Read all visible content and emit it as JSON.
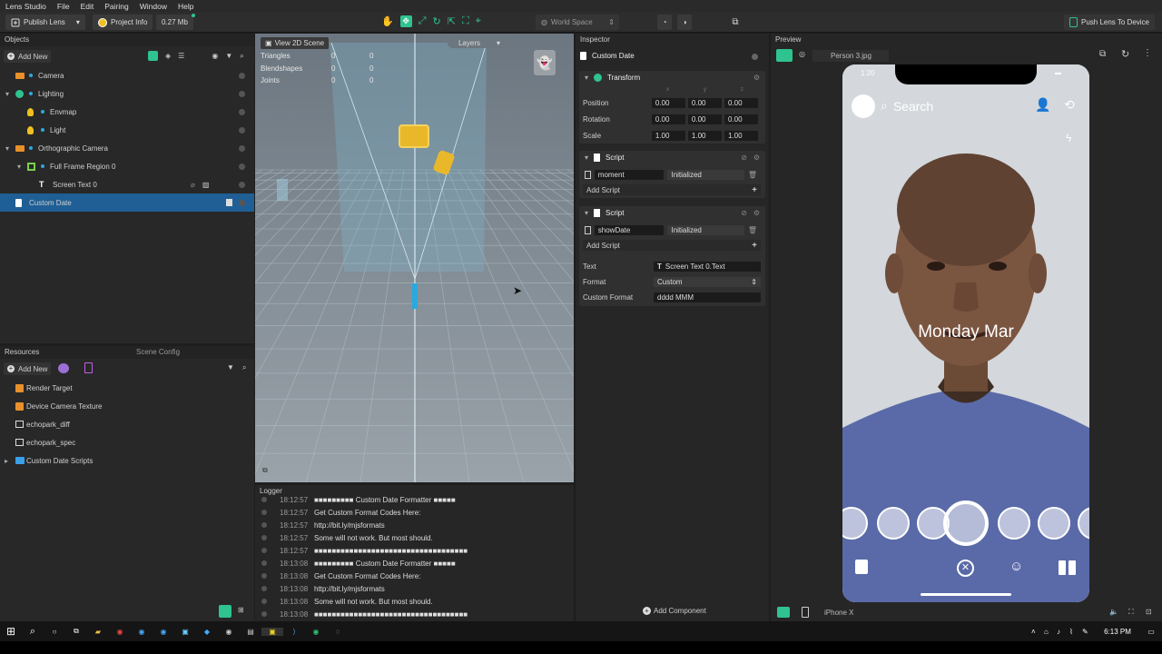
{
  "menu": [
    "Lens Studio",
    "File",
    "Edit",
    "Pairing",
    "Window",
    "Help"
  ],
  "toolbar": {
    "publish": "Publish Lens",
    "project_info": "Project Info",
    "size": "0.27 Mb",
    "space": "World Space",
    "push": "Push Lens To Device"
  },
  "objects": {
    "title": "Objects",
    "add_new": "Add New",
    "items": [
      {
        "label": "Camera",
        "indent": 0,
        "arrow": "",
        "icon": "camera",
        "color": "#e8902b"
      },
      {
        "label": "Lighting",
        "indent": 0,
        "arrow": "▾",
        "icon": "light-group",
        "color": "#2fc38f"
      },
      {
        "label": "Envmap",
        "indent": 1,
        "arrow": "",
        "icon": "bulb",
        "color": "#f0c020"
      },
      {
        "label": "Light",
        "indent": 1,
        "arrow": "",
        "icon": "bulb",
        "color": "#f0c020"
      },
      {
        "label": "Orthographic Camera",
        "indent": 0,
        "arrow": "▾",
        "icon": "camera",
        "color": "#e8902b"
      },
      {
        "label": "Full Frame Region 0",
        "indent": 1,
        "arrow": "▾",
        "icon": "frame",
        "color": "#7ad04a"
      },
      {
        "label": "Screen Text 0",
        "indent": 2,
        "arrow": "",
        "icon": "text",
        "color": "#ffffff"
      },
      {
        "label": "Custom Date",
        "indent": 0,
        "arrow": "",
        "icon": "script",
        "color": "#ffffff"
      }
    ]
  },
  "resources": {
    "title": "Resources",
    "tab2": "Scene Config",
    "add_new": "Add New",
    "items": [
      {
        "label": "Render Target",
        "icon": "render"
      },
      {
        "label": "Device Camera Texture",
        "icon": "camtex"
      },
      {
        "label": "echopark_diff",
        "icon": "image"
      },
      {
        "label": "echopark_spec",
        "icon": "image"
      },
      {
        "label": "Custom Date Scripts",
        "icon": "folder"
      }
    ]
  },
  "scene": {
    "view2d": "View 2D Scene",
    "layers": "Layers",
    "stats": [
      {
        "k": "Triangles",
        "a": "0",
        "b": "0"
      },
      {
        "k": "Blendshapes",
        "a": "0",
        "b": "0"
      },
      {
        "k": "Joints",
        "a": "0",
        "b": "0"
      }
    ]
  },
  "logger": {
    "title": "Logger",
    "lines": [
      {
        "t": "18:12:57",
        "m": "■■■■■■■■■ Custom Date Formatter ■■■■■"
      },
      {
        "t": "18:12:57",
        "m": "Get Custom Format Codes Here:"
      },
      {
        "t": "18:12:57",
        "m": "http://bit.ly/mjsformats"
      },
      {
        "t": "18:12:57",
        "m": "Some will not work. But most should."
      },
      {
        "t": "18:12:57",
        "m": "■■■■■■■■■■■■■■■■■■■■■■■■■■■■■■■■■■■"
      },
      {
        "t": "18:13:08",
        "m": "■■■■■■■■■ Custom Date Formatter ■■■■■"
      },
      {
        "t": "18:13:08",
        "m": "Get Custom Format Codes Here:"
      },
      {
        "t": "18:13:08",
        "m": "http://bit.ly/mjsformats"
      },
      {
        "t": "18:13:08",
        "m": "Some will not work. But most should."
      },
      {
        "t": "18:13:08",
        "m": "■■■■■■■■■■■■■■■■■■■■■■■■■■■■■■■■■■■"
      }
    ]
  },
  "inspector": {
    "title": "Inspector",
    "object": "Custom Date",
    "transform": {
      "title": "Transform",
      "axes": [
        "x",
        "y",
        "z"
      ],
      "rows": [
        {
          "k": "Position",
          "v": [
            "0.00",
            "0.00",
            "0.00"
          ]
        },
        {
          "k": "Rotation",
          "v": [
            "0.00",
            "0.00",
            "0.00"
          ]
        },
        {
          "k": "Scale",
          "v": [
            "1.00",
            "1.00",
            "1.00"
          ]
        }
      ]
    },
    "script1": {
      "title": "Script",
      "name": "moment",
      "event": "Initialized",
      "add": "Add Script"
    },
    "script2": {
      "title": "Script",
      "name": "showDate",
      "event": "Initialized",
      "add": "Add Script"
    },
    "props": {
      "text_label": "Text",
      "text_value": "Screen Text 0.Text",
      "format_label": "Format",
      "format_value": "Custom",
      "cf_label": "Custom Format",
      "cf_value": "dddd MMM"
    },
    "add_component": "Add Component"
  },
  "preview": {
    "title": "Preview",
    "image": "Person 3.jpg",
    "time": "1:20",
    "search": "Search",
    "overlay_text": "Monday Mar",
    "device": "iPhone X"
  },
  "taskbar": {
    "time": "6:13 PM"
  },
  "colors": {
    "selection": "#1f5f95",
    "accent": "#2fc38f"
  }
}
